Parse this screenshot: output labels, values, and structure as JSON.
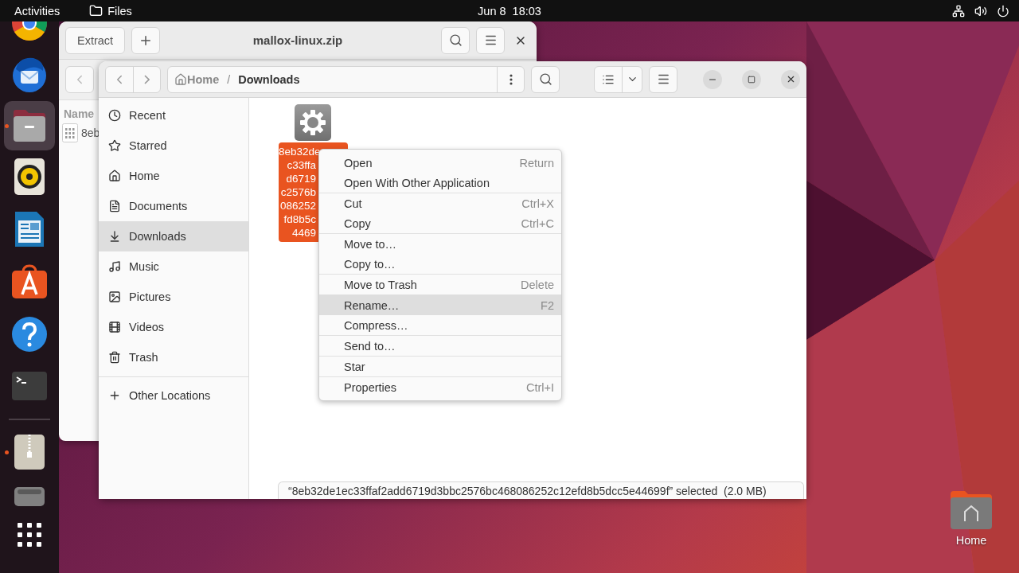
{
  "top_bar": {
    "activities": "Activities",
    "app_name": "Files",
    "clock": "Jun 8  18:03"
  },
  "dock": {
    "items": [
      {
        "kind": "browser",
        "running": false,
        "focused": false
      },
      {
        "kind": "mail",
        "running": false,
        "focused": false
      },
      {
        "kind": "files",
        "running": true,
        "focused": true
      },
      {
        "kind": "music-player",
        "running": false,
        "focused": false
      },
      {
        "kind": "writer",
        "running": false,
        "focused": false
      },
      {
        "kind": "app-store",
        "running": false,
        "focused": false
      },
      {
        "kind": "help",
        "running": false,
        "focused": false
      },
      {
        "kind": "terminal",
        "running": false,
        "focused": false
      },
      {
        "kind": "separator",
        "running": false,
        "focused": false
      },
      {
        "kind": "archive",
        "running": true,
        "focused": false
      },
      {
        "kind": "drive",
        "running": false,
        "focused": false
      },
      {
        "kind": "apps-grid",
        "running": false,
        "focused": false
      }
    ]
  },
  "desktop_icons": [
    {
      "label": "Home"
    }
  ],
  "archive_window": {
    "extract_button": "Extract",
    "title": "mallox-linux.zip",
    "column_1": "Name",
    "rows": [
      {
        "name": "8eb"
      }
    ]
  },
  "files_window": {
    "path_separator": "/",
    "path": [
      {
        "label": "Home",
        "kind": "home"
      },
      {
        "label": "Downloads",
        "kind": "folder"
      }
    ],
    "sidebar": {
      "items": [
        {
          "label": "Recent",
          "kind": "recent",
          "selected": false
        },
        {
          "label": "Starred",
          "kind": "starred",
          "selected": false
        },
        {
          "label": "Home",
          "kind": "home",
          "selected": false
        },
        {
          "label": "Documents",
          "kind": "documents",
          "selected": false
        },
        {
          "label": "Downloads",
          "kind": "downloads",
          "selected": true
        },
        {
          "label": "Music",
          "kind": "music",
          "selected": false
        },
        {
          "label": "Pictures",
          "kind": "pictures",
          "selected": false
        },
        {
          "label": "Videos",
          "kind": "videos",
          "selected": false
        },
        {
          "label": "Trash",
          "kind": "trash",
          "selected": false
        }
      ],
      "other_locations": "Other Locations"
    },
    "files": [
      {
        "name_lines": [
          "8eb32de",
          "c33ffa",
          "d6719",
          "c2576b",
          "086252",
          "fd8b5c",
          "4469"
        ],
        "selected": true
      }
    ],
    "status": "“8eb32de1ec33ffaf2add6719d3bbc2576bc468086252c12efd8b5dcc5e44699f” selected  (2.0 MB)"
  },
  "context_menu": {
    "groups": [
      [
        {
          "label": "Open",
          "shortcut": "Return",
          "highlighted": false
        },
        {
          "label": "Open With Other Application",
          "highlighted": false
        }
      ],
      [
        {
          "label": "Cut",
          "shortcut": "Ctrl+X",
          "highlighted": false
        },
        {
          "label": "Copy",
          "shortcut": "Ctrl+C",
          "highlighted": false
        }
      ],
      [
        {
          "label": "Move to…",
          "highlighted": false
        },
        {
          "label": "Copy to…",
          "highlighted": false
        }
      ],
      [
        {
          "label": "Move to Trash",
          "shortcut": "Delete",
          "highlighted": false
        }
      ],
      [
        {
          "label": "Rename…",
          "shortcut": "F2",
          "highlighted": true
        },
        {
          "label": "Compress…",
          "highlighted": false
        }
      ],
      [
        {
          "label": "Send to…",
          "highlighted": false
        }
      ],
      [
        {
          "label": "Star",
          "highlighted": false
        }
      ],
      [
        {
          "label": "Properties",
          "shortcut": "Ctrl+I",
          "highlighted": false
        }
      ]
    ]
  }
}
